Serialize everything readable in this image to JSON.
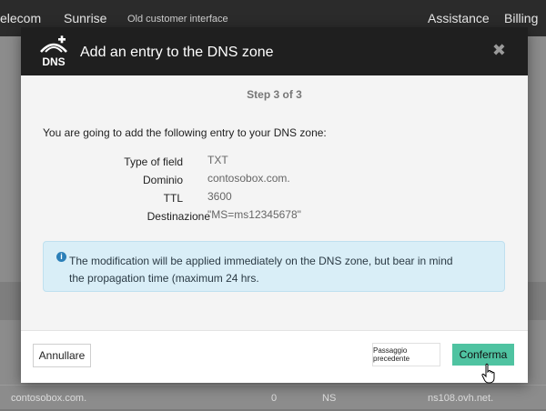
{
  "background": {
    "nav": {
      "brand": "elecom",
      "product": "Sunrise",
      "old_interface": "Old customer interface",
      "assistance": "Assistance",
      "billing": "Billing"
    },
    "rows": [
      {
        "name": "contosobox.com.",
        "ttl": "0",
        "type": "NS",
        "target": "ns108.ovh.net."
      }
    ]
  },
  "modal": {
    "title": "Add an entry to the DNS zone",
    "logo_text": "DNS",
    "close_icon": "close-icon",
    "step": "Step 3 of 3",
    "intro": "You are going to add the following entry to your DNS zone:",
    "fields": [
      {
        "label": "Type of field",
        "value": "TXT"
      },
      {
        "label": "Dominio",
        "value": "contosobox.com."
      },
      {
        "label": "TTL",
        "value": "3600"
      },
      {
        "label": "Destinazione",
        "value": "\"MS=ms12345678\""
      }
    ],
    "info": "The modification will be applied immediately on the DNS zone, but bear in mind the propagation time (maximum 24 hrs.",
    "buttons": {
      "cancel": "Annullare",
      "previous": "Passaggio precedente",
      "confirm": "Conferma"
    }
  },
  "colors": {
    "header": "#1f1f1f",
    "confirm": "#4fc3a1",
    "info_bg": "#d9eef7",
    "info_icon": "#2b7fb8"
  }
}
